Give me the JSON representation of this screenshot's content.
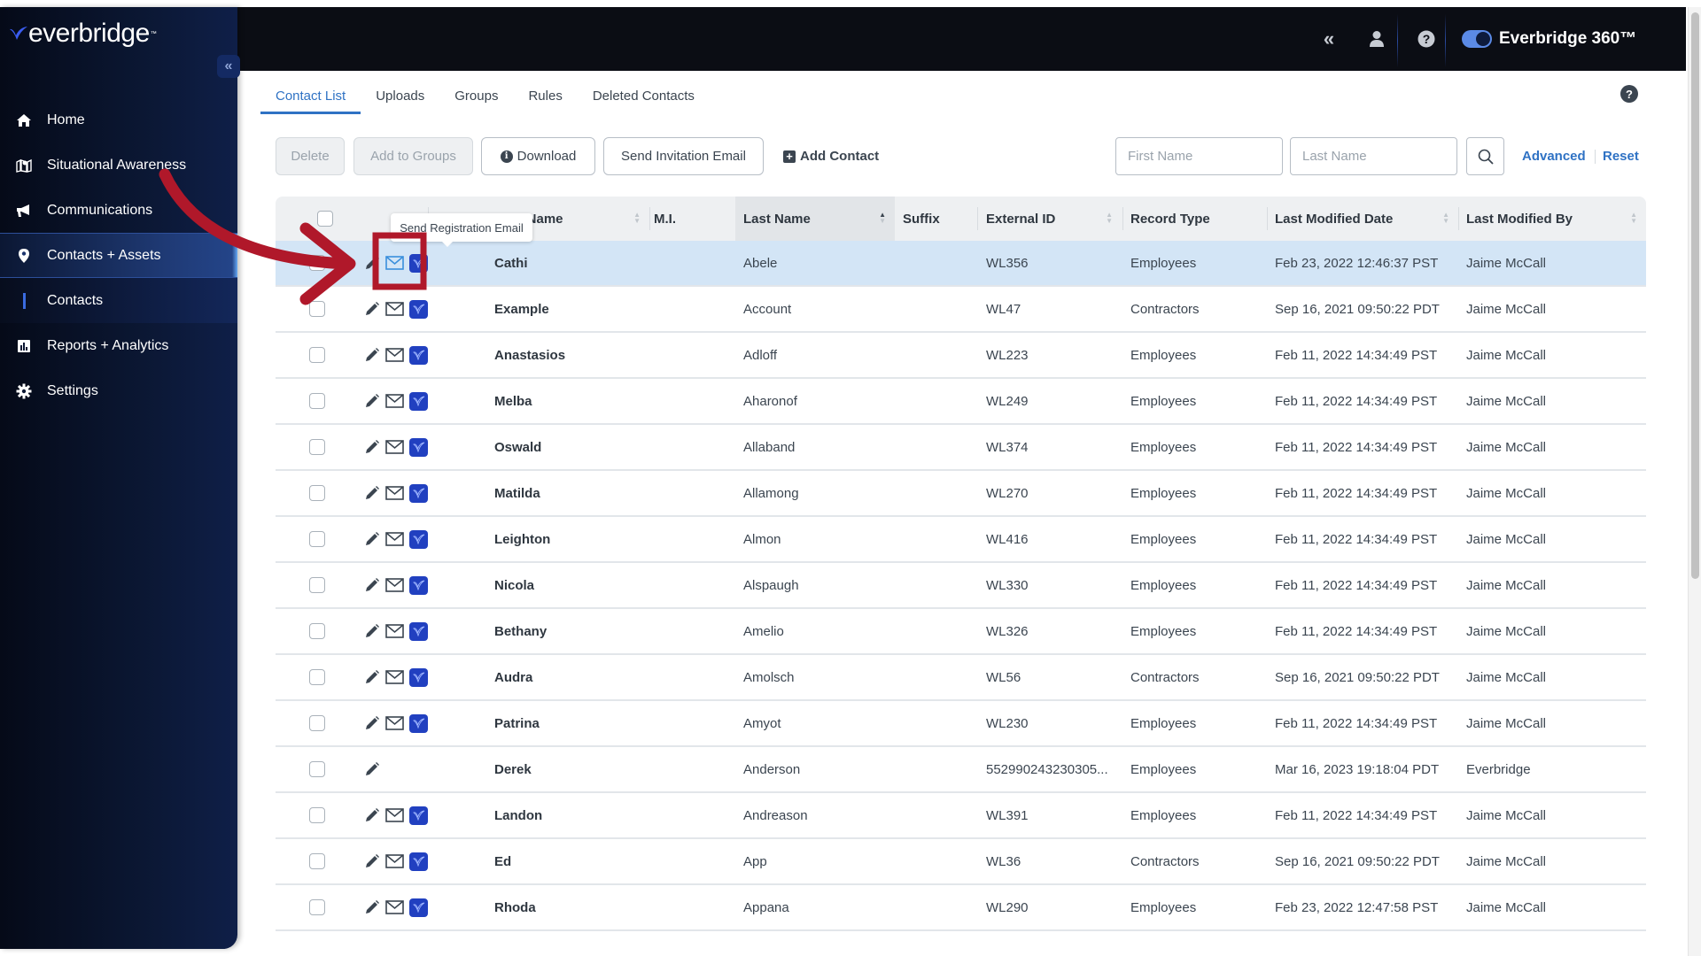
{
  "header": {
    "collapse_icon": "double-chevron-left-icon",
    "user_icon": "user-icon",
    "help_icon": "question-circle-icon",
    "toggle_on": true,
    "brand": "Everbridge 360™"
  },
  "sidebar": {
    "logo_text": "everbridge",
    "logo_tm": "™",
    "collapse_label": "«",
    "items": [
      {
        "label": "Home",
        "icon": "home-icon"
      },
      {
        "label": "Situational Awareness",
        "icon": "map-pin-icon"
      },
      {
        "label": "Communications",
        "icon": "megaphone-icon"
      },
      {
        "label": "Contacts + Assets",
        "icon": "location-pin-icon",
        "active": true
      },
      {
        "label": "Contacts",
        "sub": true
      },
      {
        "label": "Reports + Analytics",
        "icon": "bar-chart-icon"
      },
      {
        "label": "Settings",
        "icon": "gear-icon"
      }
    ]
  },
  "tabs": [
    {
      "label": "Contact List",
      "active": true
    },
    {
      "label": "Uploads"
    },
    {
      "label": "Groups"
    },
    {
      "label": "Rules"
    },
    {
      "label": "Deleted Contacts"
    }
  ],
  "toolbar": {
    "delete_label": "Delete",
    "add_to_groups_label": "Add to Groups",
    "download_label": "Download",
    "send_invitation_label": "Send Invitation Email",
    "add_contact_label": "Add Contact",
    "first_name_placeholder": "First Name",
    "last_name_placeholder": "Last Name",
    "advanced_label": "Advanced",
    "reset_label": "Reset"
  },
  "tooltip": "Send Registration Email",
  "table": {
    "columns": [
      "First Name",
      "M.I.",
      "Last Name",
      "Suffix",
      "External ID",
      "Record Type",
      "Last Modified Date",
      "Last Modified By"
    ],
    "sorted_column": "Last Name",
    "rows": [
      {
        "first": "Cathi",
        "mi": "",
        "last": "Abele",
        "suffix": "",
        "ext_id": "WL356",
        "type": "Employees",
        "modified": "Feb 23, 2022 12:46:37 PST",
        "by": "Jaime McCall",
        "email": true,
        "highlighted": true
      },
      {
        "first": "Example",
        "mi": "",
        "last": "Account",
        "suffix": "",
        "ext_id": "WL47",
        "type": "Contractors",
        "modified": "Sep 16, 2021 09:50:22 PDT",
        "by": "Jaime McCall",
        "email": true
      },
      {
        "first": "Anastasios",
        "mi": "",
        "last": "Adloff",
        "suffix": "",
        "ext_id": "WL223",
        "type": "Employees",
        "modified": "Feb 11, 2022 14:34:49 PST",
        "by": "Jaime McCall",
        "email": true
      },
      {
        "first": "Melba",
        "mi": "",
        "last": "Aharonof",
        "suffix": "",
        "ext_id": "WL249",
        "type": "Employees",
        "modified": "Feb 11, 2022 14:34:49 PST",
        "by": "Jaime McCall",
        "email": true
      },
      {
        "first": "Oswald",
        "mi": "",
        "last": "Allaband",
        "suffix": "",
        "ext_id": "WL374",
        "type": "Employees",
        "modified": "Feb 11, 2022 14:34:49 PST",
        "by": "Jaime McCall",
        "email": true
      },
      {
        "first": "Matilda",
        "mi": "",
        "last": "Allamong",
        "suffix": "",
        "ext_id": "WL270",
        "type": "Employees",
        "modified": "Feb 11, 2022 14:34:49 PST",
        "by": "Jaime McCall",
        "email": true
      },
      {
        "first": "Leighton",
        "mi": "",
        "last": "Almon",
        "suffix": "",
        "ext_id": "WL416",
        "type": "Employees",
        "modified": "Feb 11, 2022 14:34:49 PST",
        "by": "Jaime McCall",
        "email": true
      },
      {
        "first": "Nicola",
        "mi": "",
        "last": "Alspaugh",
        "suffix": "",
        "ext_id": "WL330",
        "type": "Employees",
        "modified": "Feb 11, 2022 14:34:49 PST",
        "by": "Jaime McCall",
        "email": true
      },
      {
        "first": "Bethany",
        "mi": "",
        "last": "Amelio",
        "suffix": "",
        "ext_id": "WL326",
        "type": "Employees",
        "modified": "Feb 11, 2022 14:34:49 PST",
        "by": "Jaime McCall",
        "email": true
      },
      {
        "first": "Audra",
        "mi": "",
        "last": "Amolsch",
        "suffix": "",
        "ext_id": "WL56",
        "type": "Contractors",
        "modified": "Sep 16, 2021 09:50:22 PDT",
        "by": "Jaime McCall",
        "email": true
      },
      {
        "first": "Patrina",
        "mi": "",
        "last": "Amyot",
        "suffix": "",
        "ext_id": "WL230",
        "type": "Employees",
        "modified": "Feb 11, 2022 14:34:49 PST",
        "by": "Jaime McCall",
        "email": true
      },
      {
        "first": "Derek",
        "mi": "",
        "last": "Anderson",
        "suffix": "",
        "ext_id": "552990243230305...",
        "type": "Employees",
        "modified": "Mar 16, 2023 19:18:04 PDT",
        "by": "Everbridge",
        "email": false
      },
      {
        "first": "Landon",
        "mi": "",
        "last": "Andreason",
        "suffix": "",
        "ext_id": "WL391",
        "type": "Employees",
        "modified": "Feb 11, 2022 14:34:49 PST",
        "by": "Jaime McCall",
        "email": true
      },
      {
        "first": "Ed",
        "mi": "",
        "last": "App",
        "suffix": "",
        "ext_id": "WL36",
        "type": "Contractors",
        "modified": "Sep 16, 2021 09:50:22 PDT",
        "by": "Jaime McCall",
        "email": true
      },
      {
        "first": "Rhoda",
        "mi": "",
        "last": "Appana",
        "suffix": "",
        "ext_id": "WL290",
        "type": "Employees",
        "modified": "Feb 23, 2022 12:47:58 PST",
        "by": "Jaime McCall",
        "email": true
      }
    ]
  },
  "colors": {
    "accent": "#2f72c4",
    "highlight_row": "#d3e5f6",
    "annotation_red": "#b0182a",
    "brand_blue": "#2140c0",
    "header_bg": "#0b0d14",
    "sidebar_bg": "#0b1733"
  }
}
